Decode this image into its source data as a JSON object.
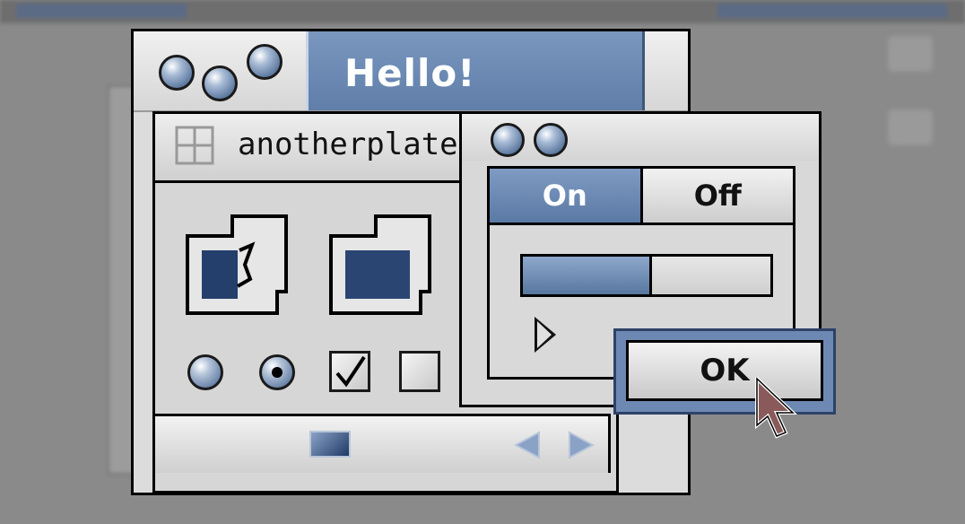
{
  "main_window": {
    "title": "Hello!"
  },
  "inner_window": {
    "title": "anotherplate"
  },
  "dialog": {
    "segments": [
      {
        "label": "On",
        "selected": true
      },
      {
        "label": "Off",
        "selected": false
      }
    ],
    "progress": 0.52,
    "ok_label": "OK"
  },
  "controls": {
    "radio_selected_index": 1,
    "checkbox_checked": [
      true,
      false
    ]
  },
  "colors": {
    "accent": "#6d88b2",
    "title_plate": "#5f7ea8",
    "window_bg": "#dcdcdc"
  },
  "icons": [
    "grid-icon",
    "finder-folder-icon",
    "folder-icon",
    "scroll-left-arrow-icon",
    "scroll-right-arrow-icon",
    "disclosure-triangle-icon",
    "pointer-cursor-icon"
  ]
}
